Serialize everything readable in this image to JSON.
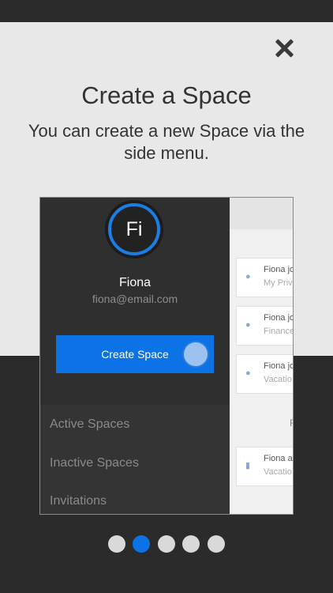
{
  "overlay": {
    "title": "Create a Space",
    "subtitle": "You can create a new Space via the side menu."
  },
  "preview": {
    "avatar_initials": "Fi",
    "user_name": "Fiona",
    "user_email": "fiona@email.com",
    "create_button_label": "Create Space",
    "menu_items": [
      "Active Spaces",
      "Inactive Spaces",
      "Invitations"
    ],
    "cards": [
      {
        "line1": "Fiona jo",
        "line2": "My Priv",
        "icon": "person-icon"
      },
      {
        "line1": "Fiona jo",
        "line2": "Finance",
        "icon": "person-icon"
      },
      {
        "line1": "Fiona jo",
        "line2": "Vacatio",
        "icon": "person-icon"
      },
      {
        "line1": "Fiona a",
        "line2": "Vacatio",
        "icon": "document-icon"
      }
    ],
    "section_letter": "F"
  },
  "pager": {
    "count": 5,
    "active_index": 1
  },
  "colors": {
    "accent": "#0b73e6",
    "dark_bg": "#2b2b2b",
    "light_bg": "#e8e8e8"
  }
}
